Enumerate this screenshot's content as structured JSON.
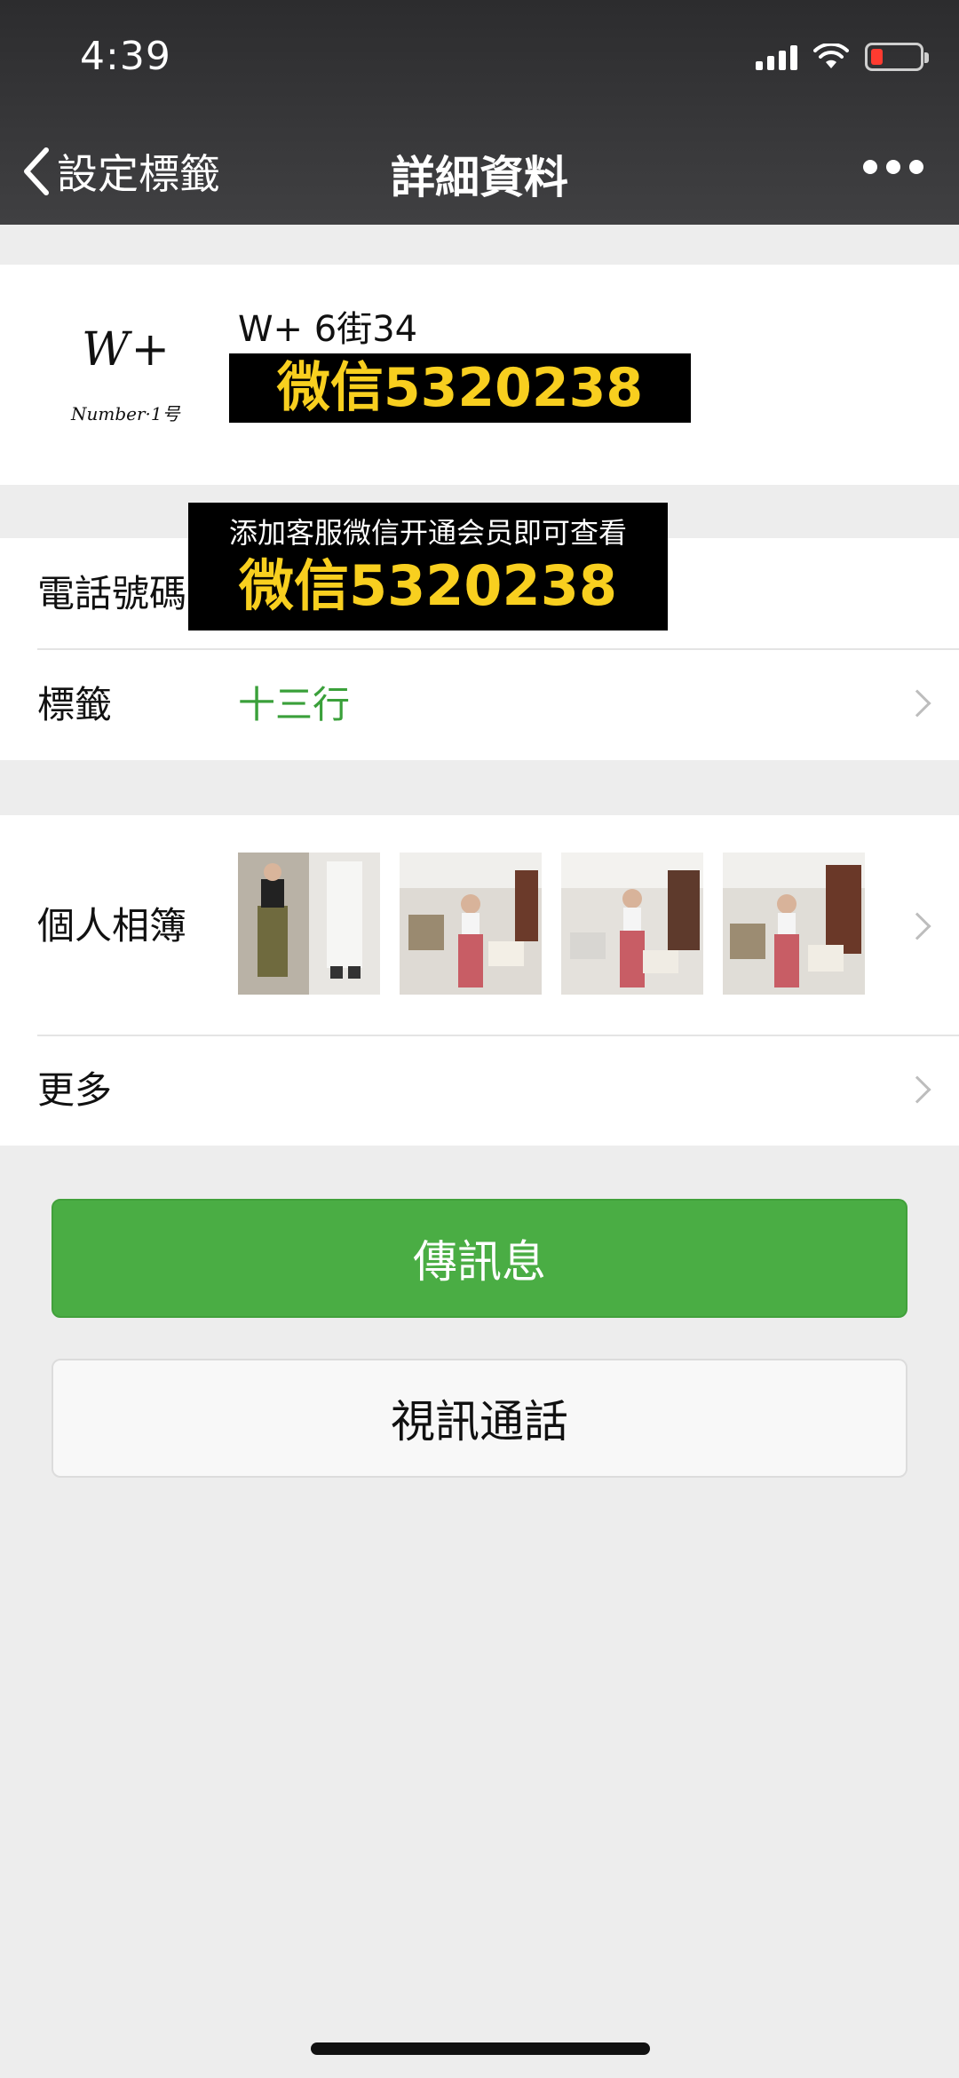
{
  "status_bar": {
    "time": "4:39"
  },
  "nav": {
    "back_label": "設定標籤",
    "title": "詳細資料"
  },
  "profile": {
    "avatar_logo_main": "W+",
    "avatar_logo_sub": "Number·1号",
    "name": "W+  6街34",
    "overlay_text": "微信5320238"
  },
  "info": {
    "phone_label": "電話號碼",
    "tag_label": "標籤",
    "tag_value": "十三行",
    "overlay_small": "添加客服微信开通会员即可查看",
    "overlay_big": "微信5320238"
  },
  "album": {
    "label": "個人相簿",
    "photo_count": 4
  },
  "more": {
    "label": "更多"
  },
  "buttons": {
    "send_message": "傳訊息",
    "video_call": "視訊通話"
  },
  "colors": {
    "accent_green": "#4aad44",
    "tag_green": "#3aa03a",
    "overlay_yellow": "#f8cf1f",
    "header_bg": "#3a3a3c",
    "battery_low": "#ff3b30"
  }
}
